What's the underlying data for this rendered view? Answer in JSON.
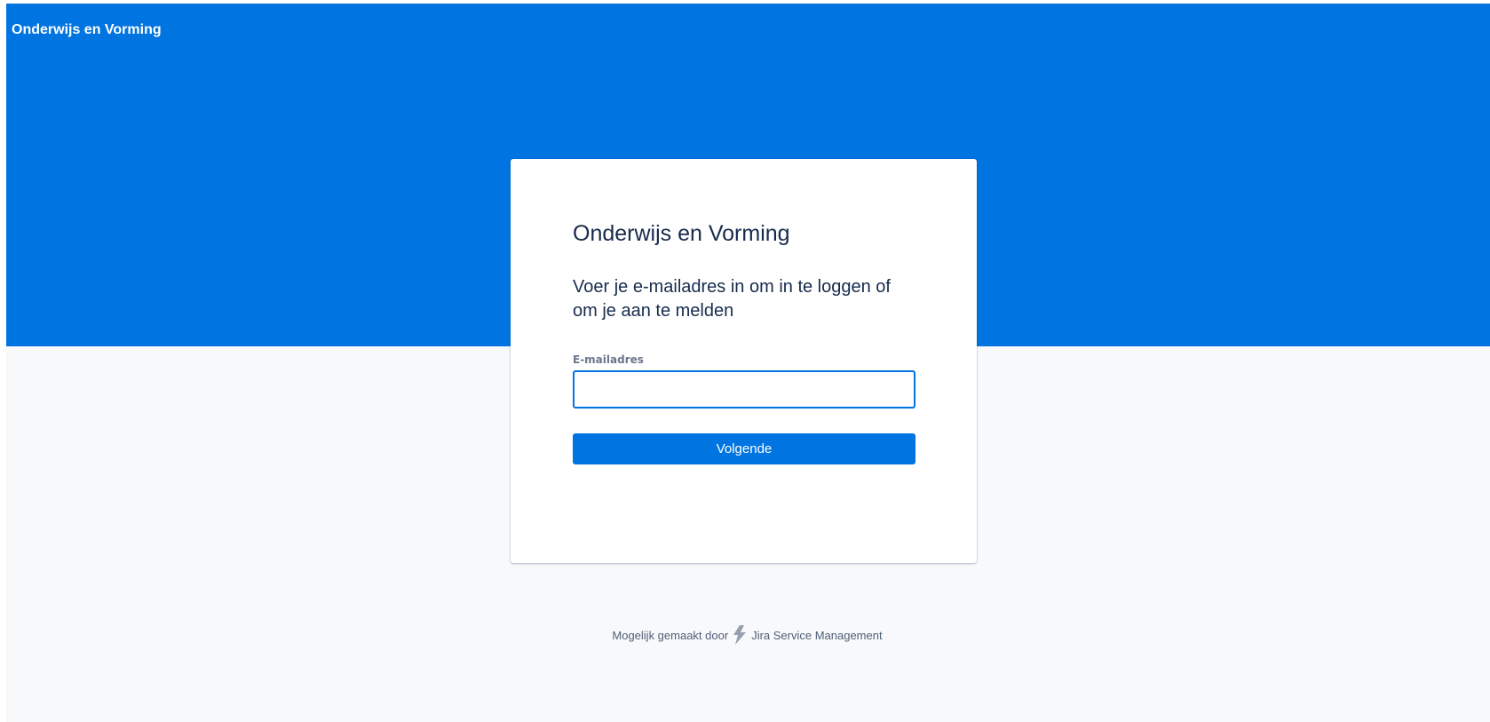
{
  "header": {
    "site_title": "Onderwijs en Vorming"
  },
  "login_card": {
    "title": "Onderwijs en Vorming",
    "subtitle": "Voer je e-mailadres in om in te loggen of om je aan te melden",
    "email_label": "E-mailadres",
    "email_value": "",
    "next_button_label": "Volgende"
  },
  "footer": {
    "powered_by_text": "Mogelijk gemaakt door",
    "product_icon": "jira-service-management-bolt-icon",
    "product_name": "Jira Service Management"
  },
  "colors": {
    "brand_blue": "#0074e0",
    "page_background": "#f8f9fa",
    "heading_text": "#172b4d",
    "footer_text": "#505f79"
  }
}
